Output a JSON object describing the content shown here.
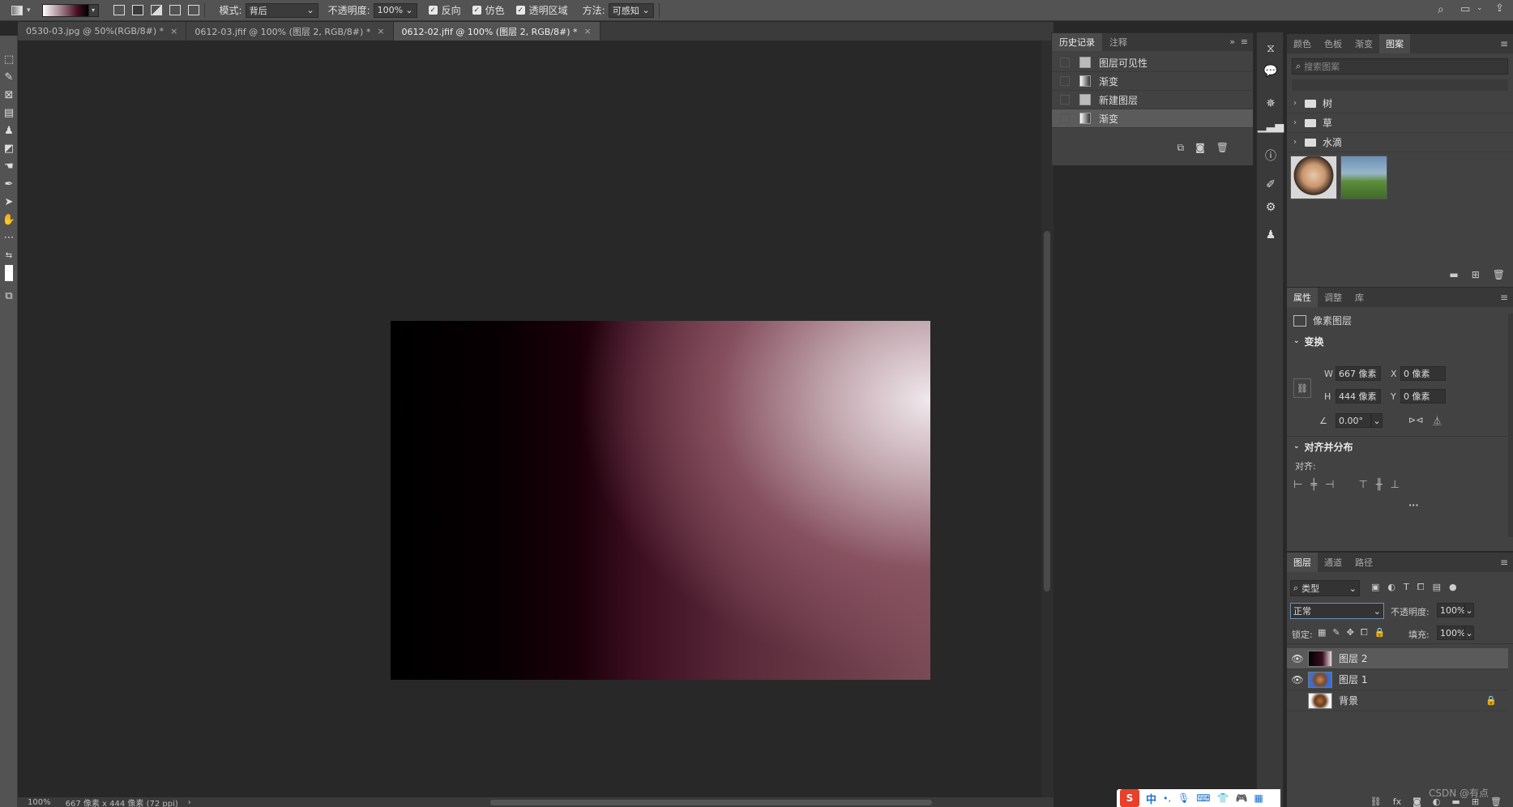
{
  "options_bar": {
    "mode_label": "模式:",
    "mode_value": "背后",
    "opacity_label": "不透明度:",
    "opacity_value": "100%",
    "reverse_label": "反向",
    "dither_label": "仿色",
    "transparency_label": "透明区域",
    "method_label": "方法:",
    "method_value": "可感知"
  },
  "tabs": [
    {
      "label": "0530-03.jpg @ 50%(RGB/8#) *",
      "close": "×"
    },
    {
      "label": "0612-03.jfif @ 100% (图层 2, RGB/8#) *",
      "close": "×"
    },
    {
      "label": "0612-02.jfif @ 100% (图层 2, RGB/8#) *",
      "close": "×"
    }
  ],
  "status": {
    "zoom": "100%",
    "doc_info": "667 像素 x 444 像素 (72 ppi)",
    "arrow": "›"
  },
  "history": {
    "tabs": [
      "历史记录",
      "注释"
    ],
    "items": [
      "图层可见性",
      "渐变",
      "新建图层",
      "渐变"
    ]
  },
  "patterns_panel": {
    "tabs": [
      "颜色",
      "色板",
      "渐变",
      "图案"
    ],
    "search_placeholder": "搜索图案",
    "folders": [
      "树",
      "草",
      "水滴"
    ]
  },
  "properties_panel": {
    "tabs": [
      "属性",
      "调整",
      "库"
    ],
    "layer_type": "像素图层",
    "transform_title": "变换",
    "w_label": "W",
    "w_value": "667 像素",
    "h_label": "H",
    "h_value": "444 像素",
    "x_label": "X",
    "x_value": "0 像素",
    "y_label": "Y",
    "y_value": "0 像素",
    "angle_value": "0.00°",
    "align_title": "对齐并分布",
    "align_label": "对齐:",
    "more": "···"
  },
  "layers_panel": {
    "tabs": [
      "图层",
      "通道",
      "路径"
    ],
    "filter_value": "类型",
    "blend_mode": "正常",
    "opacity_label": "不透明度:",
    "opacity_value": "100%",
    "lock_label": "锁定:",
    "fill_label": "填充:",
    "fill_value": "100%",
    "layers": [
      {
        "name": "图层 2",
        "visible": true,
        "selected": true
      },
      {
        "name": "图层 1",
        "visible": true,
        "selected": false
      },
      {
        "name": "背景",
        "visible": false,
        "selected": false,
        "locked": true
      }
    ]
  },
  "taskbar": {
    "ime_chinese": "中",
    "ime_punct": "•,",
    "watermark": "CSDN @有点"
  },
  "icons": [
    "search-icon",
    "workspace-icon",
    "share-icon",
    "eye-icon",
    "lock-icon",
    "folder-icon",
    "camera-icon",
    "trash-icon",
    "link-icon"
  ]
}
